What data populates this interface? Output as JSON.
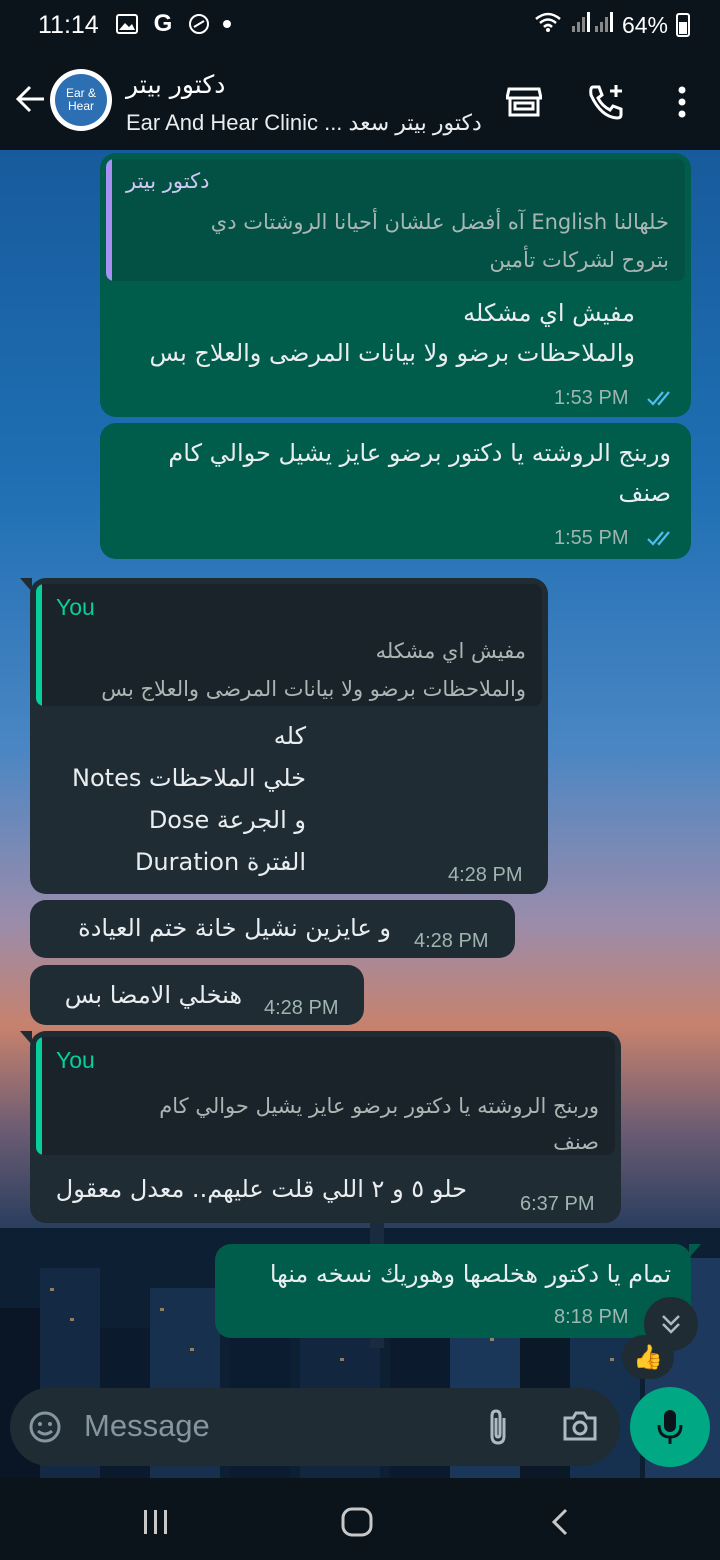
{
  "status_bar": {
    "time": "11:14",
    "battery": "64%",
    "icons": [
      "gallery-icon",
      "google-icon",
      "vpn-icon",
      "dot-icon",
      "wifi-icon",
      "signal-icon",
      "battery-icon"
    ],
    "google_letter": "G"
  },
  "header": {
    "contact_name": "دكتور بيتر",
    "subtitle": "Ear And Hear Clinic ... دكتور بيتر سعد",
    "avatar_text_line1": "Ear &",
    "avatar_text_line2": "Hear"
  },
  "messages": [
    {
      "direction": "outgoing",
      "quote_author": "دكتور بيتر",
      "quote_lines": [
        "خلهالنا English آه أفضل علشان أحيانا الروشتات دي",
        "بتروح لشركات تأمين"
      ],
      "lines": [
        "مفيش اي مشكله",
        "والملاحظات برضو ولا بيانات المرضى والعلاج بس"
      ],
      "time": "1:53 PM",
      "status": "read"
    },
    {
      "direction": "outgoing",
      "lines": [
        "وربنج الروشته يا دكتور برضو عايز يشيل حوالي كام",
        "صنف"
      ],
      "time": "1:55 PM",
      "status": "read"
    },
    {
      "direction": "incoming",
      "quote_author": "You",
      "quote_lines": [
        "مفيش اي مشكله",
        "والملاحظات برضو ولا بيانات المرضى والعلاج بس"
      ],
      "lines": [
        "كله",
        "خلي الملاحظات Notes",
        "و الجرعة Dose",
        "الفترة Duration"
      ],
      "time": "4:28 PM"
    },
    {
      "direction": "incoming",
      "lines": [
        "و عايزين نشيل خانة ختم العيادة"
      ],
      "time": "4:28 PM"
    },
    {
      "direction": "incoming",
      "lines": [
        "هنخلي الامضا بس"
      ],
      "time": "4:28 PM"
    },
    {
      "direction": "incoming",
      "quote_author": "You",
      "quote_lines": [
        "وربنج الروشته يا دكتور برضو عايز يشيل حوالي كام",
        "صنف"
      ],
      "lines": [
        "حلو ٥ و ٢ اللي قلت عليهم.. معدل معقول"
      ],
      "time": "6:37 PM"
    },
    {
      "direction": "outgoing",
      "lines": [
        "تمام يا دكتور هخلصها وهوريك نسخه منها"
      ],
      "time": "8:18 PM",
      "reaction": "👍"
    }
  ],
  "input": {
    "placeholder": "Message"
  },
  "colors": {
    "outgoing_bubble": "#005c4b",
    "incoming_bubble": "#202c33",
    "accent_green": "#00a884",
    "quote_you": "#06cf9c",
    "quote_other": "#a791f2",
    "read_ticks": "#53bdeb"
  }
}
